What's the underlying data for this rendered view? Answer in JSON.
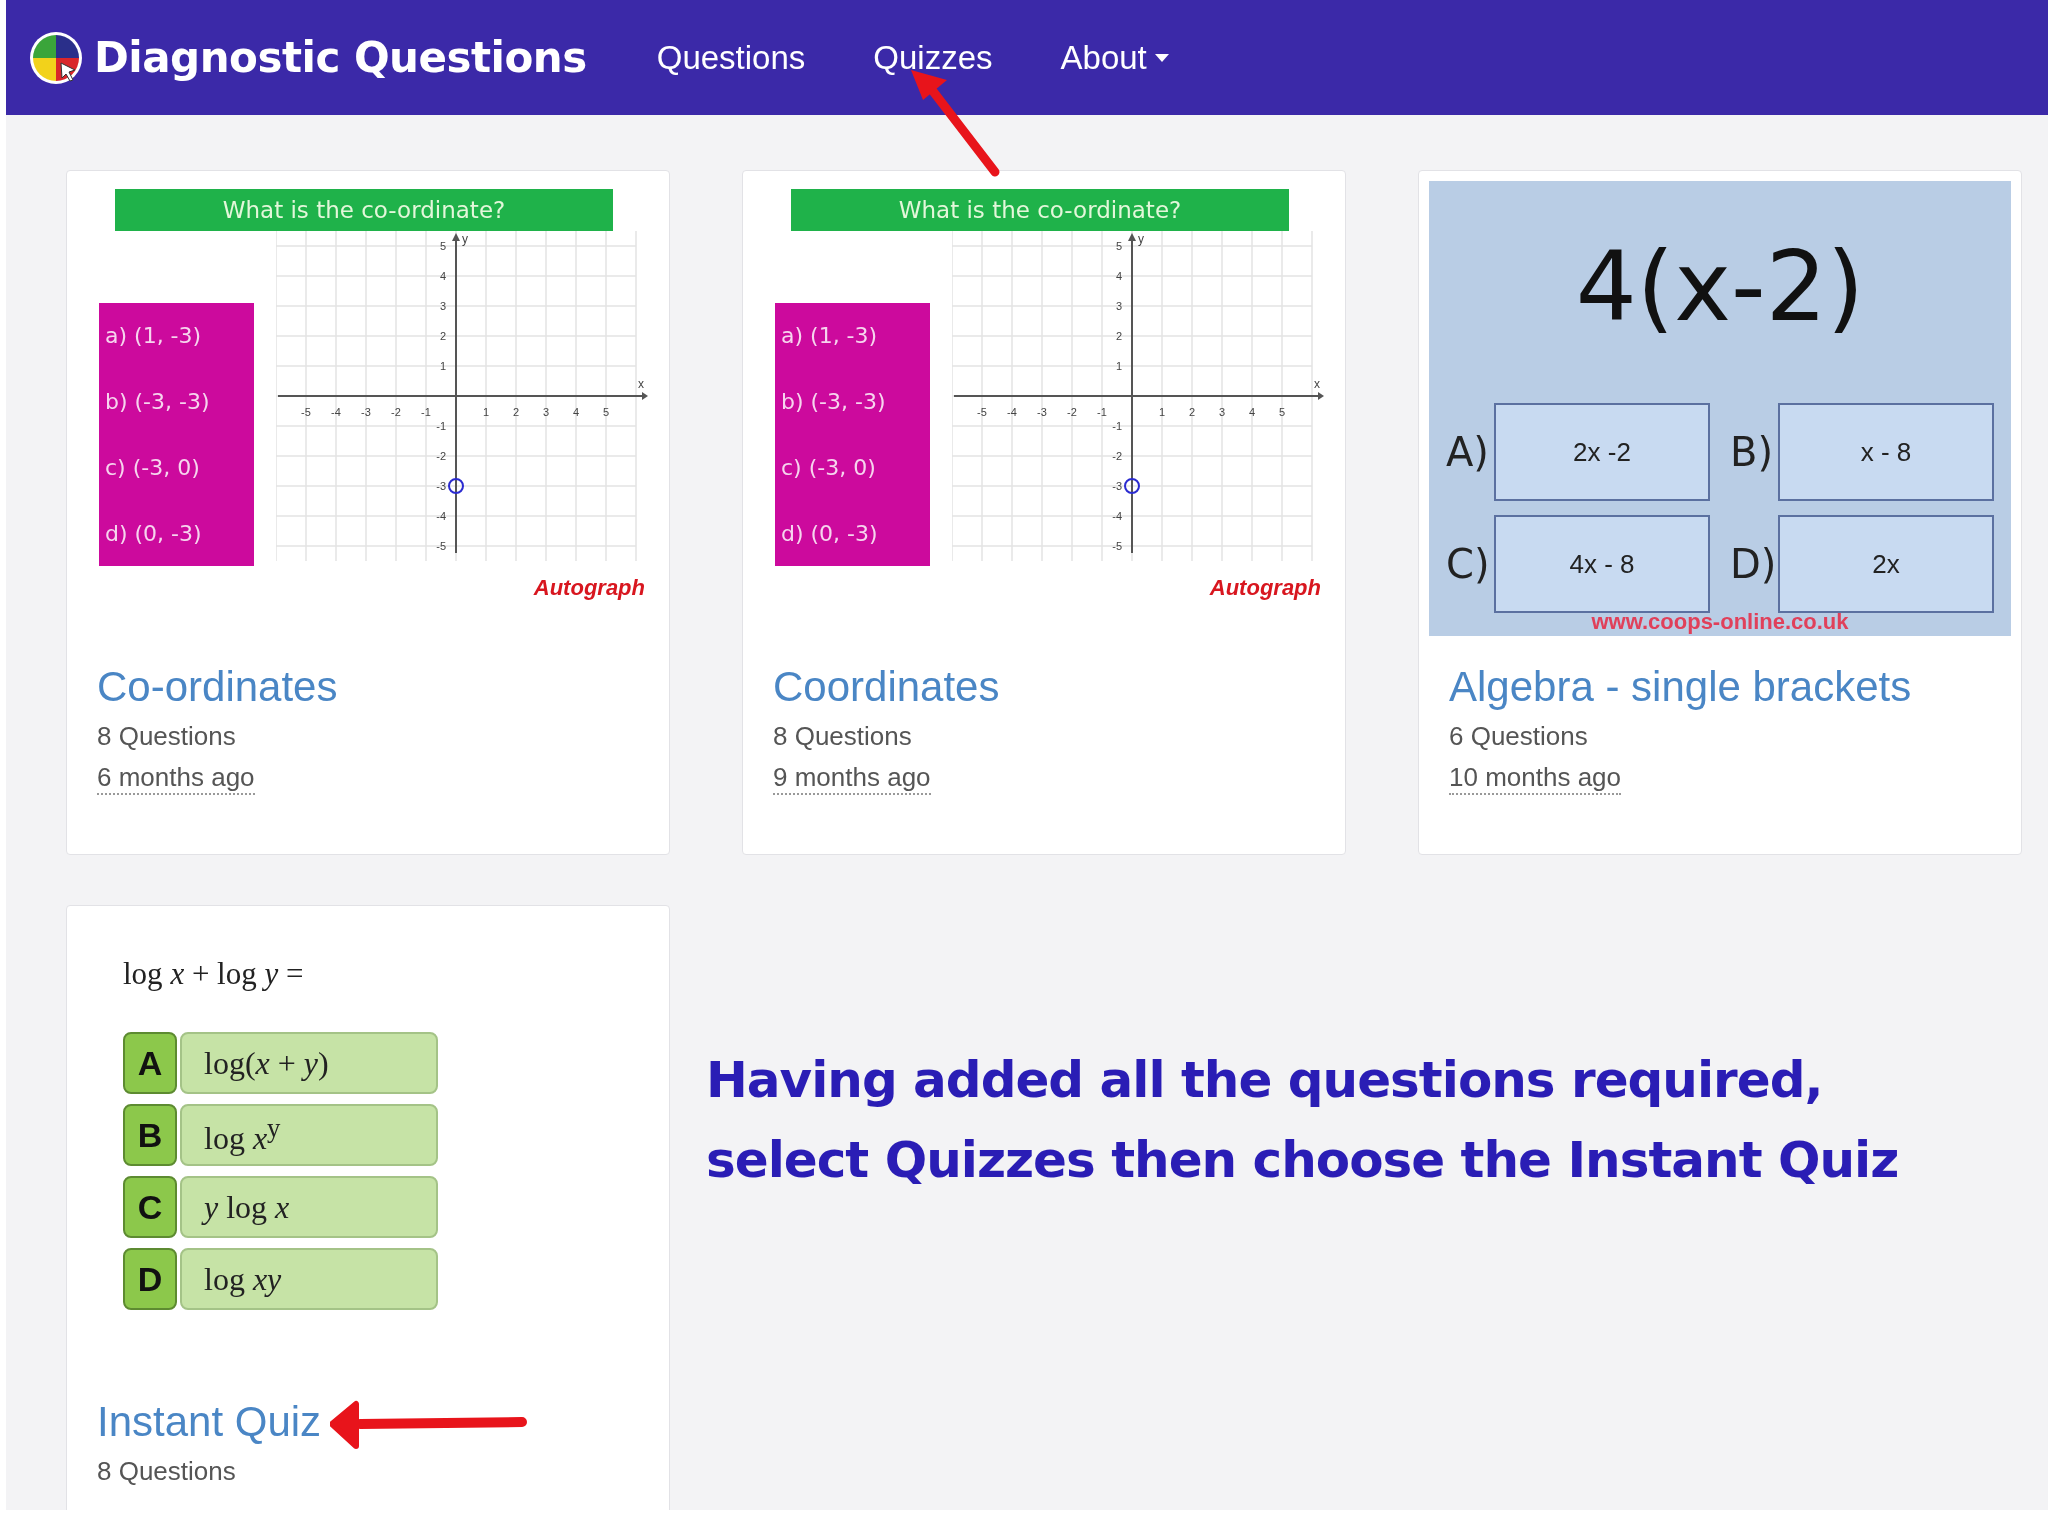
{
  "nav": {
    "brand": "Diagnostic Questions",
    "links": [
      {
        "label": "Questions",
        "dropdown": false
      },
      {
        "label": "Quizzes",
        "dropdown": false
      },
      {
        "label": "About",
        "dropdown": true
      }
    ]
  },
  "quizzes": [
    {
      "title": "Co-ordinates",
      "count": "8 Questions",
      "age": "6 months ago",
      "thumbnail": {
        "kind": "coordinate",
        "heading": "What is the co-ordinate?",
        "options": [
          "a) (1, -3)",
          "b) (-3, -3)",
          "c) (-3, 0)",
          "d) (0, -3)"
        ],
        "x_ticks": [
          "-5",
          "-4",
          "-3",
          "-2",
          "-1",
          "1",
          "2",
          "3",
          "4",
          "5"
        ],
        "y_ticks": [
          "5",
          "4",
          "3",
          "2",
          "1",
          "-1",
          "-2",
          "-3",
          "-4",
          "-5"
        ],
        "x_label": "x",
        "y_label": "y",
        "credit": "Autograph"
      }
    },
    {
      "title": "Coordinates",
      "count": "8 Questions",
      "age": "9 months ago",
      "thumbnail": {
        "kind": "coordinate",
        "heading": "What is the co-ordinate?",
        "options": [
          "a) (1, -3)",
          "b) (-3, -3)",
          "c) (-3, 0)",
          "d) (0, -3)"
        ],
        "x_ticks": [
          "-5",
          "-4",
          "-3",
          "-2",
          "-1",
          "1",
          "2",
          "3",
          "4",
          "5"
        ],
        "y_ticks": [
          "5",
          "4",
          "3",
          "2",
          "1",
          "-1",
          "-2",
          "-3",
          "-4",
          "-5"
        ],
        "x_label": "x",
        "y_label": "y",
        "credit": "Autograph"
      }
    },
    {
      "title": "Algebra - single brackets",
      "count": "6 Questions",
      "age": "10 months ago",
      "thumbnail": {
        "kind": "expand",
        "expression": "4(x-2)",
        "options": [
          {
            "letter": "A)",
            "answer": "2x -2"
          },
          {
            "letter": "B)",
            "answer": "x - 8"
          },
          {
            "letter": "C)",
            "answer": "4x - 8"
          },
          {
            "letter": "D)",
            "answer": "2x"
          }
        ],
        "credit": "www.coops-online.co.uk"
      }
    },
    {
      "title": "Instant Quiz",
      "count": "8 Questions",
      "thumbnail": {
        "kind": "choice",
        "question": "log *x* + log *y* =",
        "options": [
          {
            "letter": "A",
            "answer": "log(*x* + *y*)"
          },
          {
            "letter": "B",
            "answer": "log *x*$^{y}$"
          },
          {
            "letter": "C",
            "answer": "*y* log *x*"
          },
          {
            "letter": "D",
            "answer": "log *xy*"
          }
        ]
      }
    }
  ],
  "note": {
    "lines": [
      "Having added all the questions required,",
      "select Quizzes then choose the Instant Quiz"
    ]
  }
}
